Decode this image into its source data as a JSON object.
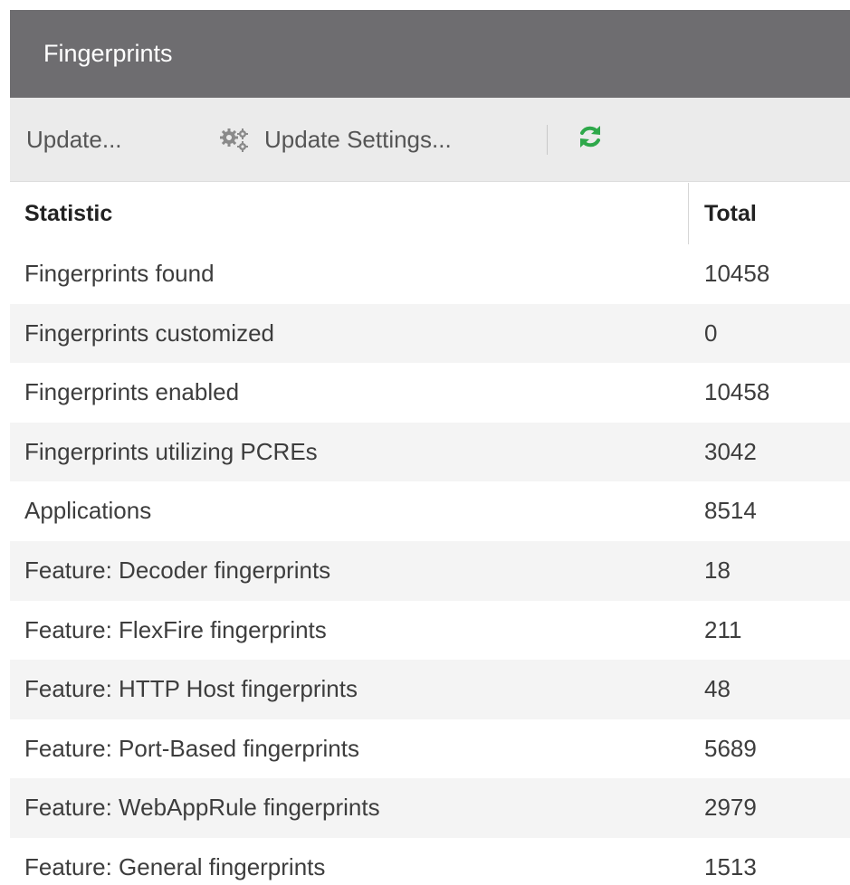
{
  "panel": {
    "title": "Fingerprints"
  },
  "toolbar": {
    "update_label": "Update...",
    "update_settings_label": "Update Settings...",
    "settings_icon": "gears-icon",
    "refresh_icon": "refresh-icon",
    "refresh_color": "#2ea84a"
  },
  "table": {
    "columns": [
      "Statistic",
      "Total"
    ],
    "rows": [
      {
        "statistic": "Fingerprints found",
        "total": "10458"
      },
      {
        "statistic": "Fingerprints customized",
        "total": "0"
      },
      {
        "statistic": "Fingerprints enabled",
        "total": "10458"
      },
      {
        "statistic": "Fingerprints utilizing PCREs",
        "total": "3042"
      },
      {
        "statistic": "Applications",
        "total": "8514"
      },
      {
        "statistic": "Feature: Decoder fingerprints",
        "total": "18"
      },
      {
        "statistic": "Feature: FlexFire fingerprints",
        "total": "211"
      },
      {
        "statistic": "Feature: HTTP Host fingerprints",
        "total": "48"
      },
      {
        "statistic": "Feature: Port-Based fingerprints",
        "total": "5689"
      },
      {
        "statistic": "Feature: WebAppRule fingerprints",
        "total": "2979"
      },
      {
        "statistic": "Feature: General fingerprints",
        "total": "1513"
      }
    ]
  },
  "colors": {
    "title_bar": "#6e6d70",
    "toolbar": "#ebebeb",
    "row_alt": "#f4f4f4"
  }
}
